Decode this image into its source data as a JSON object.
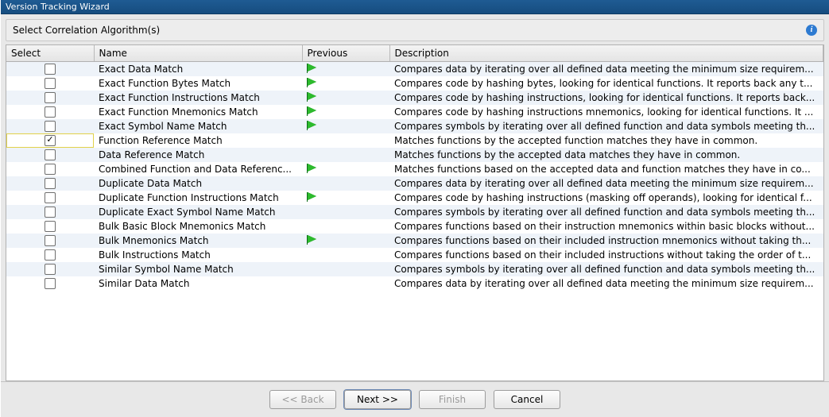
{
  "window": {
    "title": "Version Tracking Wizard"
  },
  "step": {
    "label": "Select Correlation Algorithm(s)"
  },
  "table": {
    "columns": {
      "select": "Select",
      "name": "Name",
      "previous": "Previous",
      "description": "Description"
    },
    "rows": [
      {
        "selected": false,
        "name": "Exact Data Match",
        "previous": true,
        "description": "Compares data by iterating over all defined data meeting the minimum size requirem..."
      },
      {
        "selected": false,
        "name": "Exact Function Bytes Match",
        "previous": true,
        "description": "Compares code by hashing bytes, looking for identical functions. It reports back any t..."
      },
      {
        "selected": false,
        "name": "Exact Function Instructions Match",
        "previous": true,
        "description": "Compares code by hashing instructions, looking for identical functions. It reports back..."
      },
      {
        "selected": false,
        "name": "Exact Function Mnemonics Match",
        "previous": true,
        "description": "Compares code by hashing instructions mnemonics, looking for identical functions. It ..."
      },
      {
        "selected": false,
        "name": "Exact Symbol Name Match",
        "previous": true,
        "description": "Compares symbols by iterating over all defined function and data symbols meeting th..."
      },
      {
        "selected": true,
        "name": "Function Reference Match",
        "previous": false,
        "description": "Matches functions by the accepted function matches they have in common."
      },
      {
        "selected": false,
        "name": "Data Reference Match",
        "previous": false,
        "description": "Matches functions by the accepted data matches they have in common."
      },
      {
        "selected": false,
        "name": "Combined Function and Data Referenc...",
        "previous": true,
        "description": "Matches functions based on the accepted data and function matches they have in co..."
      },
      {
        "selected": false,
        "name": "Duplicate Data Match",
        "previous": false,
        "description": "Compares data by iterating over all defined data meeting the minimum size requirem..."
      },
      {
        "selected": false,
        "name": "Duplicate Function Instructions Match",
        "previous": true,
        "description": "Compares code by hashing instructions (masking off operands), looking for identical f..."
      },
      {
        "selected": false,
        "name": "Duplicate Exact Symbol Name Match",
        "previous": false,
        "description": "Compares symbols by iterating over all defined function and data symbols meeting th..."
      },
      {
        "selected": false,
        "name": "Bulk Basic Block Mnemonics Match",
        "previous": false,
        "description": "Compares functions based on their instruction mnemonics within basic blocks without..."
      },
      {
        "selected": false,
        "name": "Bulk Mnemonics Match",
        "previous": true,
        "description": "Compares functions based on their included instruction mnemonics without taking th..."
      },
      {
        "selected": false,
        "name": "Bulk Instructions Match",
        "previous": false,
        "description": "Compares functions based on their included instructions without taking the order of t..."
      },
      {
        "selected": false,
        "name": "Similar Symbol Name Match",
        "previous": false,
        "description": "Compares symbols by iterating over all defined function and data symbols meeting th..."
      },
      {
        "selected": false,
        "name": "Similar Data Match",
        "previous": false,
        "description": "Compares data by iterating over all defined data meeting the minimum size requirem..."
      }
    ],
    "focused_row": 5
  },
  "footer": {
    "back": {
      "label": "<< Back",
      "enabled": false
    },
    "next": {
      "label": "Next >>",
      "enabled": true,
      "default": true
    },
    "finish": {
      "label": "Finish",
      "enabled": false
    },
    "cancel": {
      "label": "Cancel",
      "enabled": true
    }
  }
}
